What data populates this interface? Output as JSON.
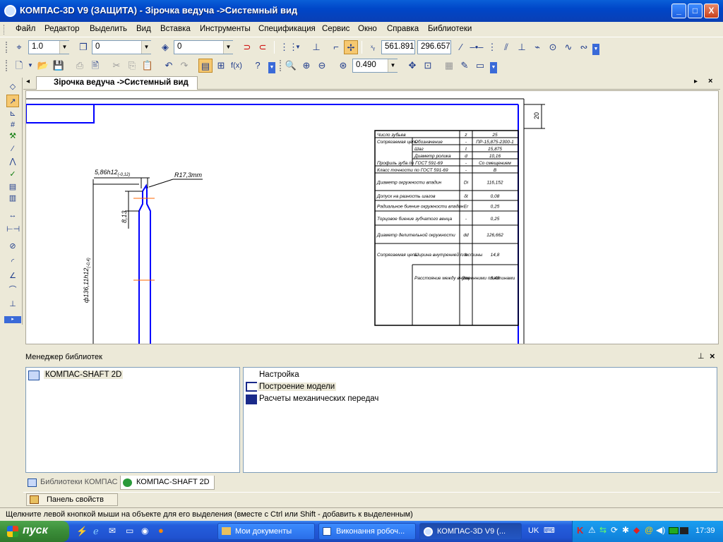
{
  "window": {
    "title": "КОМПАС-3D V9 (ЗАЩИТА) - Зірочка ведуча ->Системный вид",
    "buttons": {
      "minimize": "_",
      "maximize": "□",
      "close": "X"
    }
  },
  "menu": [
    "Файл",
    "Редактор",
    "Выделить",
    "Вид",
    "Вставка",
    "Инструменты",
    "Спецификация",
    "Сервис",
    "Окно",
    "Справка",
    "Библиотеки"
  ],
  "toolbar1": {
    "line_scale": "1.0",
    "layer": "0",
    "style": "0",
    "coord_x": "561.891",
    "coord_y": "296.657"
  },
  "toolbar2": {
    "zoom": "0.490"
  },
  "document_tab": "Зірочка ведуча ->Системный вид",
  "drawing": {
    "dim_20": "20",
    "dim_width": "5,86h12",
    "dim_width_tol": "(-0,12)",
    "dim_radius": "R17,3mm",
    "dim_height": "8,13",
    "dim_diameter": "ф136,11h12",
    "dim_diameter_tol": "(-0,4)",
    "table": [
      [
        "Число зубьев",
        "",
        "z",
        "25"
      ],
      [
        "Сопрягаемая цепь",
        "Обозначение",
        "-",
        "ПР-15,875-2300-1"
      ],
      [
        "",
        "Шаг",
        "t",
        "15,875"
      ],
      [
        "",
        "Диаметр ролика",
        "d",
        "10,16"
      ],
      [
        "Профиль зуба по ГОСТ 591-69",
        "",
        "-",
        "Со смещением"
      ],
      [
        "Класс точности по ГОСТ 591-69",
        "",
        "-",
        "В"
      ],
      [
        "Диаметр окружности впадин",
        "",
        "Di",
        "116,152"
      ],
      [
        "Допуск на разность шагов",
        "",
        "δt",
        "0,08"
      ],
      [
        "Радиальное биение окружности впадин",
        "",
        "Er",
        "0,25"
      ],
      [
        "Торцовое биение зубчатого венца",
        "",
        "-",
        "0,25"
      ],
      [
        "Диаметр делительной окружности",
        "",
        "dd",
        "126,662"
      ],
      [
        "Сопрягаемая цепь",
        "Ширина внутренней пластины",
        "h",
        "14,8"
      ],
      [
        "",
        "Расстояние между внутренними пластинами",
        "Ввн",
        "6,48"
      ]
    ]
  },
  "library_manager": {
    "title": "Менеджер библиотек",
    "tree_items": [
      "КОМПАС-SHAFT 2D"
    ],
    "list_items": [
      "Настройка",
      "Построение модели",
      "Расчеты механических передач"
    ],
    "tabs": [
      "Библиотеки КОМПАС",
      "КОМПАС-SHAFT 2D"
    ]
  },
  "property_panel": "Панель свойств",
  "status_text": "Щелкните левой кнопкой мыши на объекте для его выделения (вместе с Ctrl или Shift - добавить к выделенным)",
  "taskbar": {
    "start": "пуск",
    "tasks": [
      "Мои документы",
      "Виконання робоч...",
      "КОМПАС-3D V9 (..."
    ],
    "language": "UK",
    "clock": "17:39"
  },
  "colors": {
    "accent": "#0046c8",
    "frame": "#0000ff",
    "centerline": "#ff6600"
  }
}
